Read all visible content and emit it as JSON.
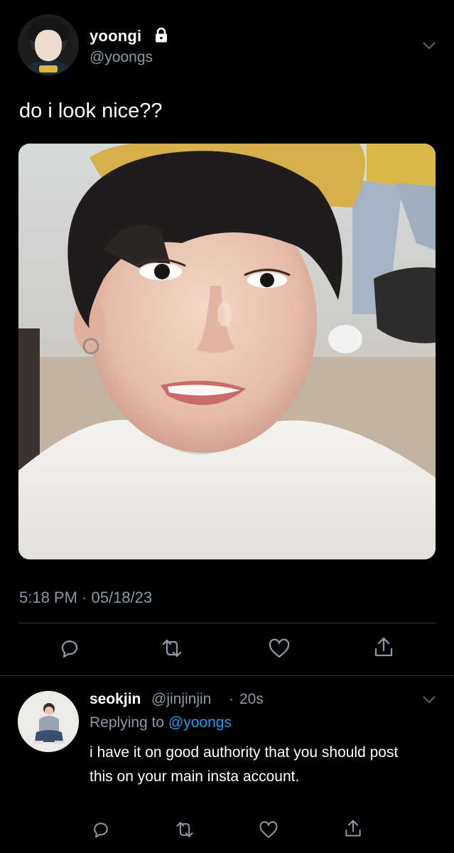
{
  "tweet": {
    "display_name": "yoongi",
    "handle": "@yoongs",
    "protected": true,
    "text": "do i look nice??",
    "timestamp": "5:18 PM · 05/18/23"
  },
  "reply": {
    "display_name": "seokjin",
    "handle": "@jinjinjin",
    "separator": "·",
    "time": "20s",
    "replying_prefix": "Replying to ",
    "replying_to": "@yoongs",
    "text": "i have it on good authority that you should post this on your main insta account."
  },
  "icons": {
    "actions": [
      "reply-icon",
      "retweet-icon",
      "like-icon",
      "share-icon"
    ],
    "lock": "lock-icon",
    "menu": "chevron-down-icon"
  },
  "colors": {
    "background": "#000000",
    "text": "#ffffff",
    "secondary": "#8b98a5",
    "link": "#1d9bf0",
    "divider": "#2f3336"
  }
}
